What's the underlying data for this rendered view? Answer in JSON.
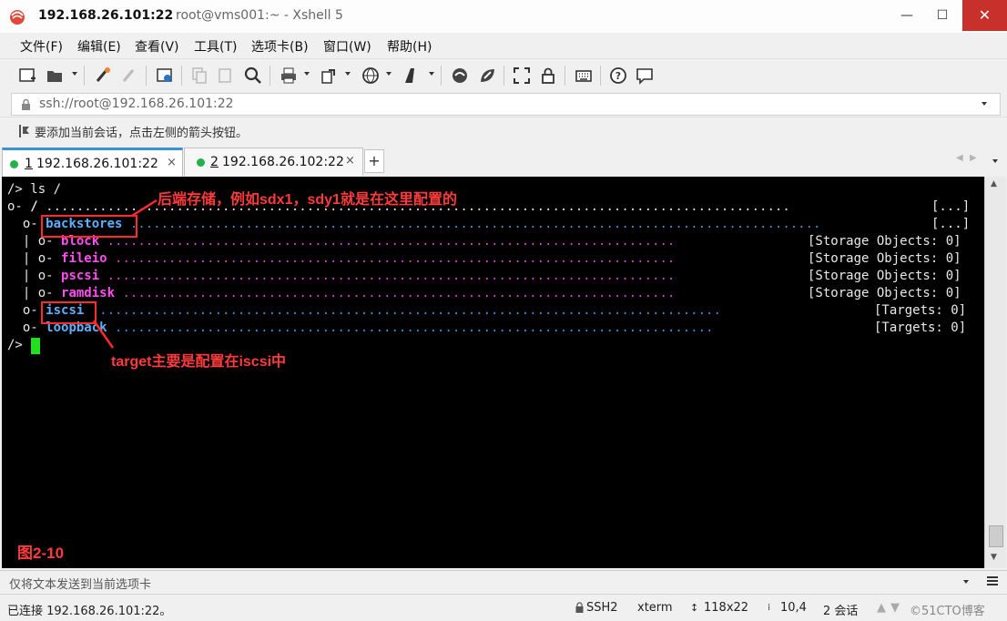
{
  "window": {
    "title_host": "192.168.26.101:22",
    "title_rest": "root@vms001:~ - Xshell 5",
    "controls": {
      "minimize": "—",
      "maximize": "☐",
      "close": "✕"
    }
  },
  "menu": [
    {
      "label": "文件(F)"
    },
    {
      "label": "编辑(E)"
    },
    {
      "label": "查看(V)"
    },
    {
      "label": "工具(T)"
    },
    {
      "label": "选项卡(B)"
    },
    {
      "label": "窗口(W)"
    },
    {
      "label": "帮助(H)"
    }
  ],
  "toolbar": {
    "icons": [
      "new-session-icon",
      "open-folder-icon",
      "reconnect-icon",
      "disconnect-icon",
      "properties-icon",
      "copy-icon",
      "paste-icon",
      "find-icon",
      "print-icon",
      "transfer-icon",
      "globe-icon",
      "font-icon",
      "xftp-icon",
      "xmanager-icon",
      "fullscreen-icon",
      "lock-icon",
      "keyboard-icon",
      "help-icon",
      "chat-icon"
    ]
  },
  "address": {
    "value": "ssh://root@192.168.26.101:22"
  },
  "hint": {
    "text": "要添加当前会话，点击左侧的箭头按钮。"
  },
  "tabs": [
    {
      "num": "1",
      "label": "192.168.26.101:22",
      "active": true,
      "status_color": "#22b14c",
      "close": "×"
    },
    {
      "num": "2",
      "label": "192.168.26.102:22",
      "active": false,
      "status_color": "#22b14c",
      "close": "×"
    }
  ],
  "tab_add": "+",
  "terminal": {
    "command": "/> ls /",
    "root": {
      "prefix": "o- ",
      "name": "/",
      "right": "[...]"
    },
    "rows": [
      {
        "prefix": "  o- ",
        "name": "backstores",
        "right": "[...]"
      },
      {
        "prefix": "  | o- ",
        "name": "block",
        "right": "[Storage Objects: 0]"
      },
      {
        "prefix": "  | o- ",
        "name": "fileio",
        "right": "[Storage Objects: 0]"
      },
      {
        "prefix": "  | o- ",
        "name": "pscsi",
        "right": "[Storage Objects: 0]"
      },
      {
        "prefix": "  | o- ",
        "name": "ramdisk",
        "right": "[Storage Objects: 0]"
      },
      {
        "prefix": "  o- ",
        "name": "iscsi",
        "right": "[Targets: 0]"
      },
      {
        "prefix": "  o- ",
        "name": "loopback",
        "right": "[Targets: 0]"
      }
    ],
    "prompt": "/>",
    "annotations": {
      "backstores": "后端存储，例如sdx1，sdy1就是在这里配置的",
      "iscsi": "target主要是配置在iscsi中",
      "figure": "图2-10"
    },
    "colors": {
      "blue_item": "#5cb0ff",
      "magenta_item": "#ff4df0",
      "annotation": "#ff3b3b"
    }
  },
  "compose": {
    "placeholder": "仅将文本发送到当前选项卡"
  },
  "status": {
    "connected": "已连接 192.168.26.101:22。",
    "protocol": "SSH2",
    "term": "xterm",
    "size": "118x22",
    "cursor": "10,4",
    "sessions": "2 会话",
    "watermark": "©51CTO博客"
  }
}
